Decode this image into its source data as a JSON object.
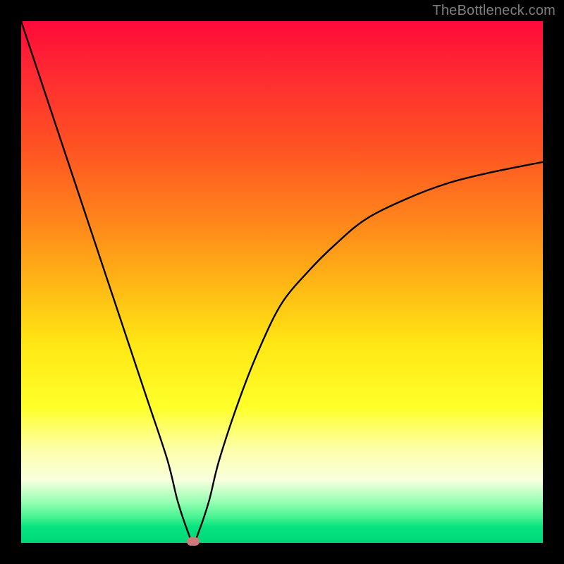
{
  "watermark": "TheBottleneck.com",
  "chart_data": {
    "type": "line",
    "title": "",
    "xlabel": "",
    "ylabel": "",
    "xlim": [
      0,
      100
    ],
    "ylim": [
      0,
      100
    ],
    "grid": false,
    "series": [
      {
        "name": "bottleneck-curve",
        "x": [
          0,
          4,
          8,
          12,
          16,
          20,
          24,
          28,
          30,
          32,
          33,
          34,
          36,
          38,
          42,
          46,
          50,
          55,
          60,
          66,
          74,
          82,
          90,
          100
        ],
        "y": [
          100,
          88,
          76,
          64,
          52,
          40,
          28,
          16,
          8,
          2,
          0,
          2,
          8,
          16,
          28,
          38,
          46,
          52,
          57,
          62,
          66,
          69,
          71,
          73
        ]
      }
    ],
    "marker": {
      "x": 33,
      "y": 0,
      "color": "#cf7a7a"
    },
    "background_gradient": {
      "top": "#ff0a3a",
      "mid_upper": "#ff8c1a",
      "mid": "#ffe714",
      "mid_lower": "#fdffa8",
      "bottom": "#00d877"
    }
  }
}
